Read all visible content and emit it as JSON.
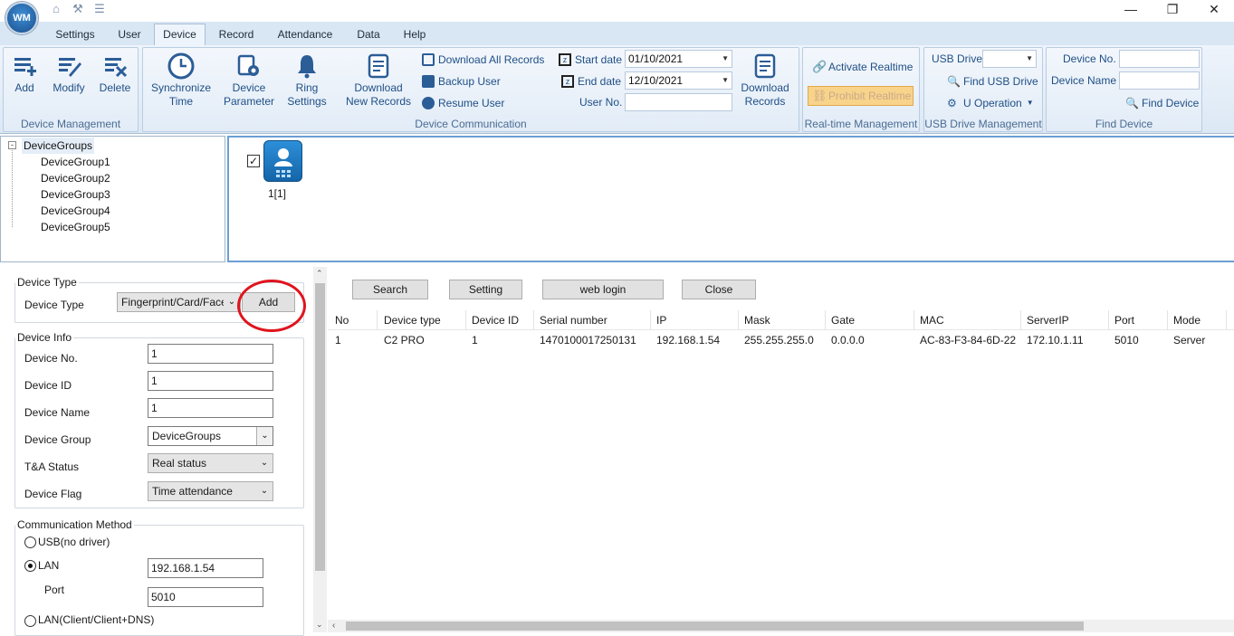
{
  "app": {
    "logo_text": "WM"
  },
  "window": {
    "minimize": "—",
    "restore": "❐",
    "close": "✕"
  },
  "tabs": [
    {
      "label": "Settings"
    },
    {
      "label": "User"
    },
    {
      "label": "Device"
    },
    {
      "label": "Record"
    },
    {
      "label": "Attendance"
    },
    {
      "label": "Data"
    },
    {
      "label": "Help"
    }
  ],
  "ribbon": {
    "device_management": {
      "title": "Device Management",
      "add": "Add",
      "modify": "Modify",
      "delete": "Delete"
    },
    "device_communication": {
      "title": "Device Communication",
      "sync_1": "Synchronize",
      "sync_2": "Time",
      "param_1": "Device",
      "param_2": "Parameter",
      "ring_1": "Ring",
      "ring_2": "Settings",
      "dl_new_1": "Download",
      "dl_new_2": "New Records",
      "dl_all": "Download All Records",
      "backup": "Backup User",
      "resume": "Resume User",
      "start_label": "Start date",
      "start_value": "01/10/2021",
      "end_label": "End date",
      "end_value": "12/10/2021",
      "userno_label": "User No.",
      "dl_rec_1": "Download",
      "dl_rec_2": "Records"
    },
    "realtime": {
      "title": "Real-time Management",
      "activate": "Activate Realtime",
      "prohibit": "Prohibit Realtime"
    },
    "usb": {
      "title": "USB Drive Management",
      "drive_label": "USB Drive",
      "find": "Find USB Drive",
      "operation": "U Operation"
    },
    "find": {
      "title": "Find Device",
      "no_label": "Device No.",
      "name_label": "Device Name",
      "find_btn": "Find Device"
    }
  },
  "tree": {
    "root": "DeviceGroups",
    "items": [
      "DeviceGroup1",
      "DeviceGroup2",
      "DeviceGroup3",
      "DeviceGroup4",
      "DeviceGroup5"
    ]
  },
  "device_tile": {
    "label": "1[1]"
  },
  "form": {
    "type_legend": "Device Type",
    "type_label": "Device Type",
    "type_value": "Fingerprint/Card/Face",
    "add_btn": "Add",
    "info_legend": "Device Info",
    "no_label": "Device No.",
    "no_value": "1",
    "id_label": "Device ID",
    "id_value": "1",
    "name_label": "Device Name",
    "name_value": "1",
    "group_label": "Device Group",
    "group_value": "DeviceGroups",
    "status_label": "T&A Status",
    "status_value": "Real status",
    "flag_label": "Device Flag",
    "flag_value": "Time attendance",
    "comm_legend": "Communication Method",
    "usb": "USB(no driver)",
    "lan": "LAN",
    "lan_ip": "192.168.1.54",
    "port_label": "Port",
    "port_value": "5010",
    "lan_client": "LAN(Client/Client+DNS)"
  },
  "actions": {
    "search": "Search",
    "setting": "Setting",
    "web_login": "web login",
    "close": "Close"
  },
  "table": {
    "headers": [
      "No",
      "Device type",
      "Device ID",
      "Serial number",
      "IP",
      "Mask",
      "Gate",
      "MAC",
      "ServerIP",
      "Port",
      "Mode"
    ],
    "rows": [
      [
        "1",
        "C2 PRO",
        "1",
        "1470100017250131",
        "192.168.1.54",
        "255.255.255.0",
        "0.0.0.0",
        "AC-83-F3-84-6D-22",
        "172.10.1.11",
        "5010",
        "Server"
      ]
    ]
  },
  "colors": {
    "accent": "#1f4f86",
    "ribbon_bg": "#dce8f5",
    "highlight_circle": "#e0141e",
    "prohibit_bg": "#f8d38a"
  }
}
